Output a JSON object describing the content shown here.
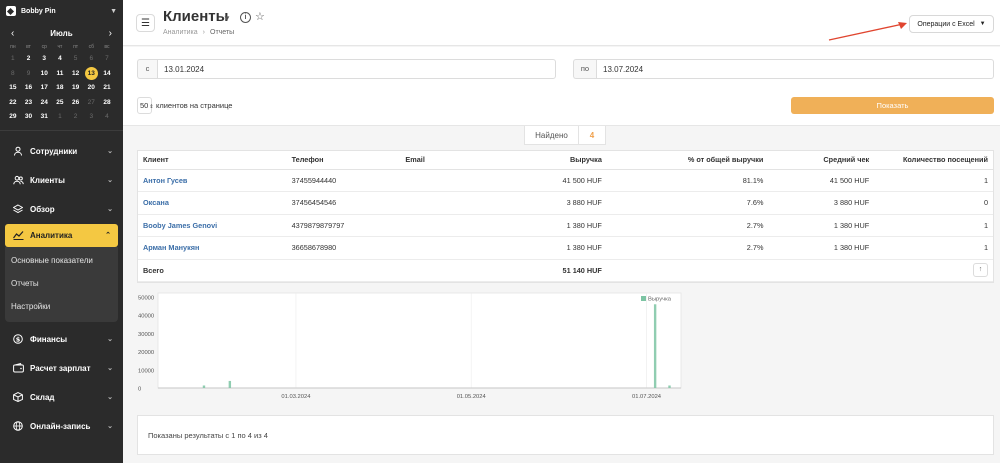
{
  "sidebar": {
    "user_name": "Bobby Pin",
    "calendar": {
      "month": "Июль",
      "weekdays": [
        "пн",
        "вт",
        "ср",
        "чт",
        "пт",
        "сб",
        "вс"
      ],
      "days": [
        {
          "d": "1",
          "muted": true
        },
        {
          "d": "2"
        },
        {
          "d": "3"
        },
        {
          "d": "4"
        },
        {
          "d": "5",
          "muted": true
        },
        {
          "d": "6",
          "muted": true
        },
        {
          "d": "7",
          "muted": true
        },
        {
          "d": "8",
          "muted": true
        },
        {
          "d": "9",
          "muted": true
        },
        {
          "d": "10"
        },
        {
          "d": "11"
        },
        {
          "d": "12"
        },
        {
          "d": "13",
          "today": true
        },
        {
          "d": "14"
        },
        {
          "d": "15"
        },
        {
          "d": "16"
        },
        {
          "d": "17"
        },
        {
          "d": "18"
        },
        {
          "d": "19"
        },
        {
          "d": "20"
        },
        {
          "d": "21"
        },
        {
          "d": "22"
        },
        {
          "d": "23"
        },
        {
          "d": "24"
        },
        {
          "d": "25"
        },
        {
          "d": "26"
        },
        {
          "d": "27",
          "muted": true
        },
        {
          "d": "28"
        },
        {
          "d": "29"
        },
        {
          "d": "30"
        },
        {
          "d": "31"
        },
        {
          "d": "1",
          "muted": true
        },
        {
          "d": "2",
          "muted": true
        },
        {
          "d": "3",
          "muted": true
        },
        {
          "d": "4",
          "muted": true
        }
      ]
    },
    "nav_top": [
      {
        "label": "Сотрудники",
        "icon": "user-icon"
      },
      {
        "label": "Клиенты",
        "icon": "users-icon"
      },
      {
        "label": "Обзор",
        "icon": "layers-icon"
      }
    ],
    "active_item": {
      "label": "Аналитика",
      "icon": "chart-icon"
    },
    "subnav": [
      "Основные показатели",
      "Отчеты",
      "Настройки"
    ],
    "nav_bottom": [
      {
        "label": "Финансы",
        "icon": "dollar-icon"
      },
      {
        "label": "Расчет зарплат",
        "icon": "wallet-icon"
      },
      {
        "label": "Склад",
        "icon": "box-icon"
      },
      {
        "label": "Онлайн-запись",
        "icon": "globe-icon"
      }
    ]
  },
  "header": {
    "title": "Клиенты",
    "breadcrumb": [
      "Аналитика",
      "Отчеты"
    ],
    "excel_button": "Операции с Excel"
  },
  "filters": {
    "from_label": "с",
    "from_value": "13.01.2024",
    "to_label": "по",
    "to_value": "13.07.2024",
    "per_page_value": "50",
    "per_page_text": "клиентов на странице",
    "show_button": "Показать"
  },
  "found": {
    "label": "Найдено",
    "value": "4"
  },
  "table": {
    "headers": [
      "Клиент",
      "Телефон",
      "Email",
      "Выручка",
      "% от общей выручки",
      "Средний чек",
      "Количество посещений"
    ],
    "rows": [
      [
        "Антон Гусев",
        "37455944440",
        "",
        "41 500 HUF",
        "81.1%",
        "41 500 HUF",
        "1"
      ],
      [
        "Оксана",
        "37456454546",
        "",
        "3 880 HUF",
        "7.6%",
        "3 880 HUF",
        "0"
      ],
      [
        "Booby James Genovi",
        "4379879879797",
        "",
        "1 380 HUF",
        "2.7%",
        "1 380 HUF",
        "1"
      ],
      [
        "Арман Манукян",
        "36658678980",
        "",
        "1 380 HUF",
        "2.7%",
        "1 380 HUF",
        "1"
      ]
    ],
    "total_label": "Всего",
    "total_revenue": "51 140 HUF"
  },
  "chart_data": {
    "type": "bar",
    "x_start": "2024-01-13",
    "x_end": "2024-07-13",
    "x_ticks": [
      "01.03.2024",
      "01.05.2024",
      "01.07.2024"
    ],
    "y_ticks": [
      "50000",
      "40000",
      "30000",
      "20000",
      "10000",
      "0"
    ],
    "ylim": [
      0,
      50000
    ],
    "series": [
      {
        "name": "Выручка",
        "color": "#7cc4a3",
        "points": [
          {
            "date": "2024-01-29",
            "value": 1380
          },
          {
            "date": "2024-02-07",
            "value": 3880
          },
          {
            "date": "2024-07-04",
            "value": 46000
          },
          {
            "date": "2024-07-09",
            "value": 1380
          }
        ]
      }
    ]
  },
  "footer": {
    "results_text": "Показаны результаты с 1 по 4 из 4"
  },
  "colors": {
    "accent": "#f4c842",
    "show_button": "#f0b058",
    "link": "#3b6ea8",
    "arrow": "#e0452f"
  }
}
